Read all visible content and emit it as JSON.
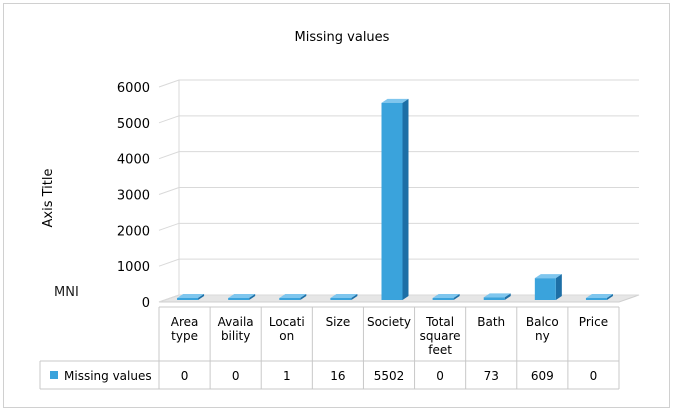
{
  "chart_data": {
    "type": "bar",
    "title": "Missing values",
    "ylabel": "Axis Title",
    "side_label": "MNI",
    "categories": [
      [
        "Area",
        "type"
      ],
      [
        "Availa",
        "bility"
      ],
      [
        "Locati",
        "on"
      ],
      [
        "Size"
      ],
      [
        "Society"
      ],
      [
        "Total",
        "square",
        "feet"
      ],
      [
        "Bath"
      ],
      [
        "Balco",
        "ny"
      ],
      [
        "Price"
      ]
    ],
    "series": [
      {
        "name": "Missing values",
        "values": [
          0,
          0,
          1,
          16,
          5502,
          0,
          73,
          609,
          0
        ]
      }
    ],
    "value_labels": [
      "0",
      "0",
      "1",
      "16",
      "5502",
      "0",
      "73",
      "609",
      "0"
    ],
    "ylim": [
      0,
      6000
    ],
    "yticks": [
      0,
      1000,
      2000,
      3000,
      4000,
      5000,
      6000
    ],
    "grid": true,
    "legend_position": "bottom-left (data table)",
    "bar_color": "#3aa3dc",
    "bar_side_color": "#1d6fa6",
    "bar_top_color": "#7fc6ee"
  }
}
